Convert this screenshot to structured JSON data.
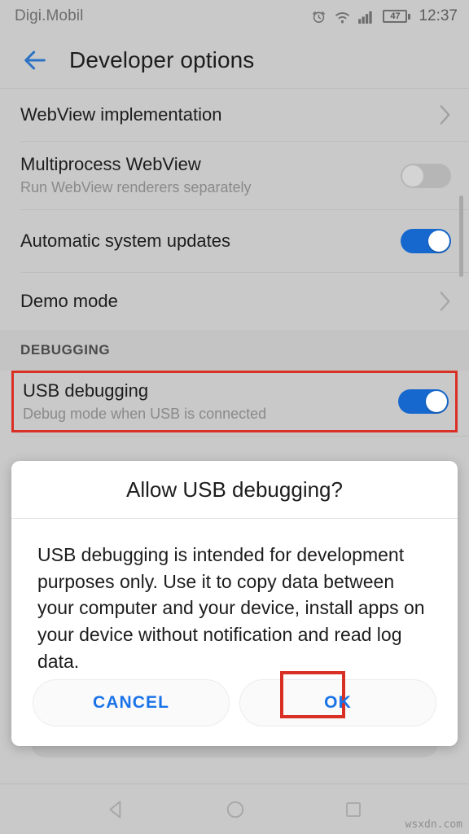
{
  "status_bar": {
    "carrier": "Digi.Mobil",
    "clock": "12:37",
    "battery_percent": "47",
    "icons": [
      "alarm-icon",
      "wifi-icon",
      "signal-icon",
      "battery-icon"
    ]
  },
  "app_bar": {
    "back_icon": "back-arrow-icon",
    "title": "Developer options"
  },
  "settings": {
    "rows": [
      {
        "title": "WebView implementation",
        "subtitle": "",
        "control": "chevron",
        "highlighted": false
      },
      {
        "title": "Multiprocess WebView",
        "subtitle": "Run WebView renderers separately",
        "control": "toggle-off",
        "highlighted": false
      },
      {
        "title": "Automatic system updates",
        "subtitle": "",
        "control": "toggle-on",
        "highlighted": false
      },
      {
        "title": "Demo mode",
        "subtitle": "",
        "control": "chevron",
        "highlighted": false
      }
    ],
    "section_header": "DEBUGGING",
    "usb_row": {
      "title": "USB debugging",
      "subtitle": "Debug mode when USB is connected",
      "control": "toggle-on",
      "highlighted": true
    }
  },
  "dialog": {
    "title": "Allow USB debugging?",
    "body": "USB debugging is intended for development purposes only. Use it to copy data between your computer and your device, install apps on your device without notification and read log data.",
    "cancel_label": "CANCEL",
    "ok_label": "OK",
    "ok_highlighted": true
  },
  "nav_bar": {
    "back": "nav-back-icon",
    "home": "nav-home-icon",
    "recents": "nav-recents-icon"
  },
  "watermark": "wsxdn.com",
  "colors": {
    "accent_blue": "#1668cf",
    "link_blue": "#1a73e8",
    "highlight_red": "#d93025",
    "background": "#c9c9c9",
    "dialog_bg": "#ffffff"
  }
}
